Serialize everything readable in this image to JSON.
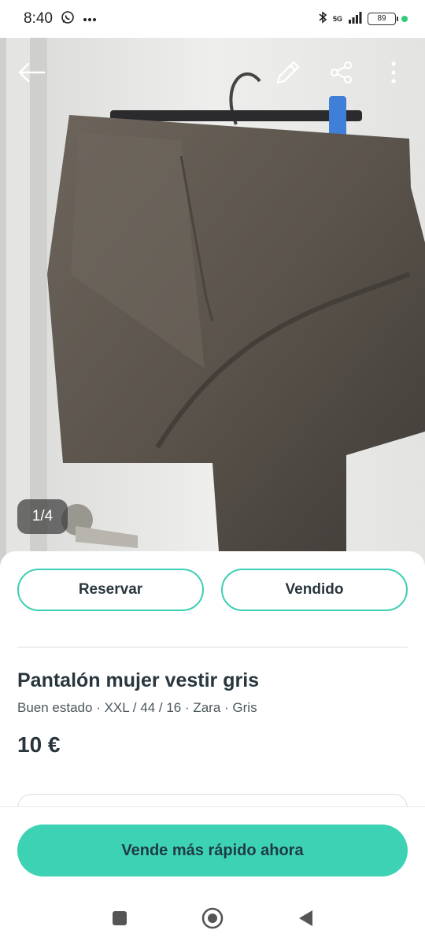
{
  "status_bar": {
    "time": "8:40",
    "battery": "89",
    "network": "5G",
    "icons": [
      "whatsapp-icon",
      "more-dots-icon",
      "bluetooth-icon",
      "signal-icon",
      "battery-icon"
    ]
  },
  "photo": {
    "counter": "1/4",
    "icons": [
      "back-arrow-icon",
      "edit-pencil-icon",
      "share-icon",
      "more-vertical-icon"
    ]
  },
  "actions": {
    "reserve_label": "Reservar",
    "sold_label": "Vendido"
  },
  "product": {
    "title": "Pantalón mujer vestir gris",
    "meta": "Buen estado · XXL / 44 / 16 · Zara · Gris",
    "price": "10 €"
  },
  "cta": {
    "label": "Vende más rápido ahora"
  },
  "nav": {
    "icons": [
      "recents-square-icon",
      "home-circle-icon",
      "back-triangle-icon"
    ]
  },
  "colors": {
    "accent": "#3dd2b4",
    "text": "#29363d"
  }
}
